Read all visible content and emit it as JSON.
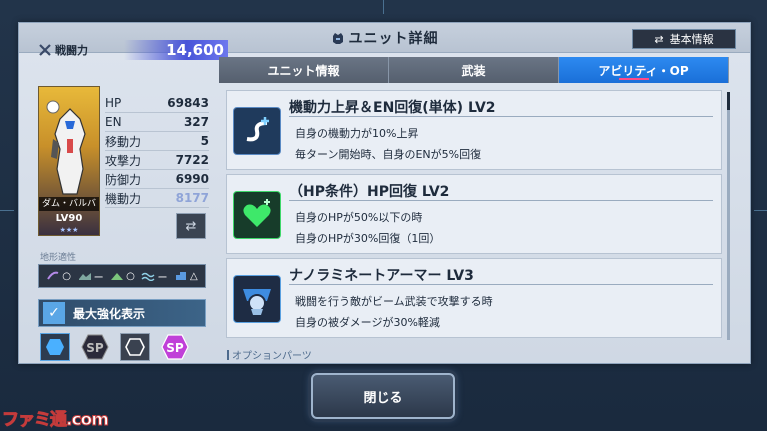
{
  "header": {
    "title": "ユニット詳細",
    "basic_info_button": "基本情報"
  },
  "unit": {
    "power_label": "戦闘力",
    "power_value": "14,600",
    "name": "ダム・バルバ",
    "level": "LV90",
    "stars": "★★★",
    "stats": [
      {
        "label": "HP",
        "value": "69843"
      },
      {
        "label": "EN",
        "value": "327"
      },
      {
        "label": "移動力",
        "value": "5"
      },
      {
        "label": "攻撃力",
        "value": "7722"
      },
      {
        "label": "防御力",
        "value": "6990"
      },
      {
        "label": "機動力",
        "value": "8177"
      }
    ]
  },
  "terrain": {
    "label": "地形適性",
    "items": [
      {
        "icon": "space-icon",
        "rank": "○"
      },
      {
        "icon": "air-icon",
        "rank": "ー"
      },
      {
        "icon": "ground-icon",
        "rank": "○"
      },
      {
        "icon": "sea-icon",
        "rank": "ー"
      },
      {
        "icon": "underwater-icon",
        "rank": "△"
      }
    ]
  },
  "max_enhance": {
    "label": "最大強化表示",
    "checked": true
  },
  "tabs": [
    {
      "label": "ユニット情報",
      "active": false
    },
    {
      "label": "武装",
      "active": false
    },
    {
      "label": "アビリティ・OP",
      "active": true
    }
  ],
  "abilities": [
    {
      "icon": "mobility-up-icon",
      "title": "機動力上昇＆EN回復(単体) LV2",
      "lines": [
        "自身の機動力が10%上昇",
        "毎ターン開始時、自身のENが5%回復"
      ]
    },
    {
      "icon": "heart-heal-icon",
      "title": "（HP条件）HP回復 LV2",
      "lines": [
        "自身のHPが50%以下の時",
        "自身のHPが30%回復（1回）"
      ]
    },
    {
      "icon": "nanolaminate-armor-icon",
      "title": "ナノラミネートアーマー LV3",
      "lines": [
        "戦闘を行う敵がビーム武装で攻撃する時",
        "自身の被ダメージが30%軽減"
      ]
    }
  ],
  "option_parts_label": "オプションパーツ",
  "close_button": "閉じる",
  "watermark": "ファミ通.com",
  "colors": {
    "accent_blue": "#1a6fd8",
    "power_bar": "#4854d8",
    "tab_inactive": "#555f6e"
  }
}
